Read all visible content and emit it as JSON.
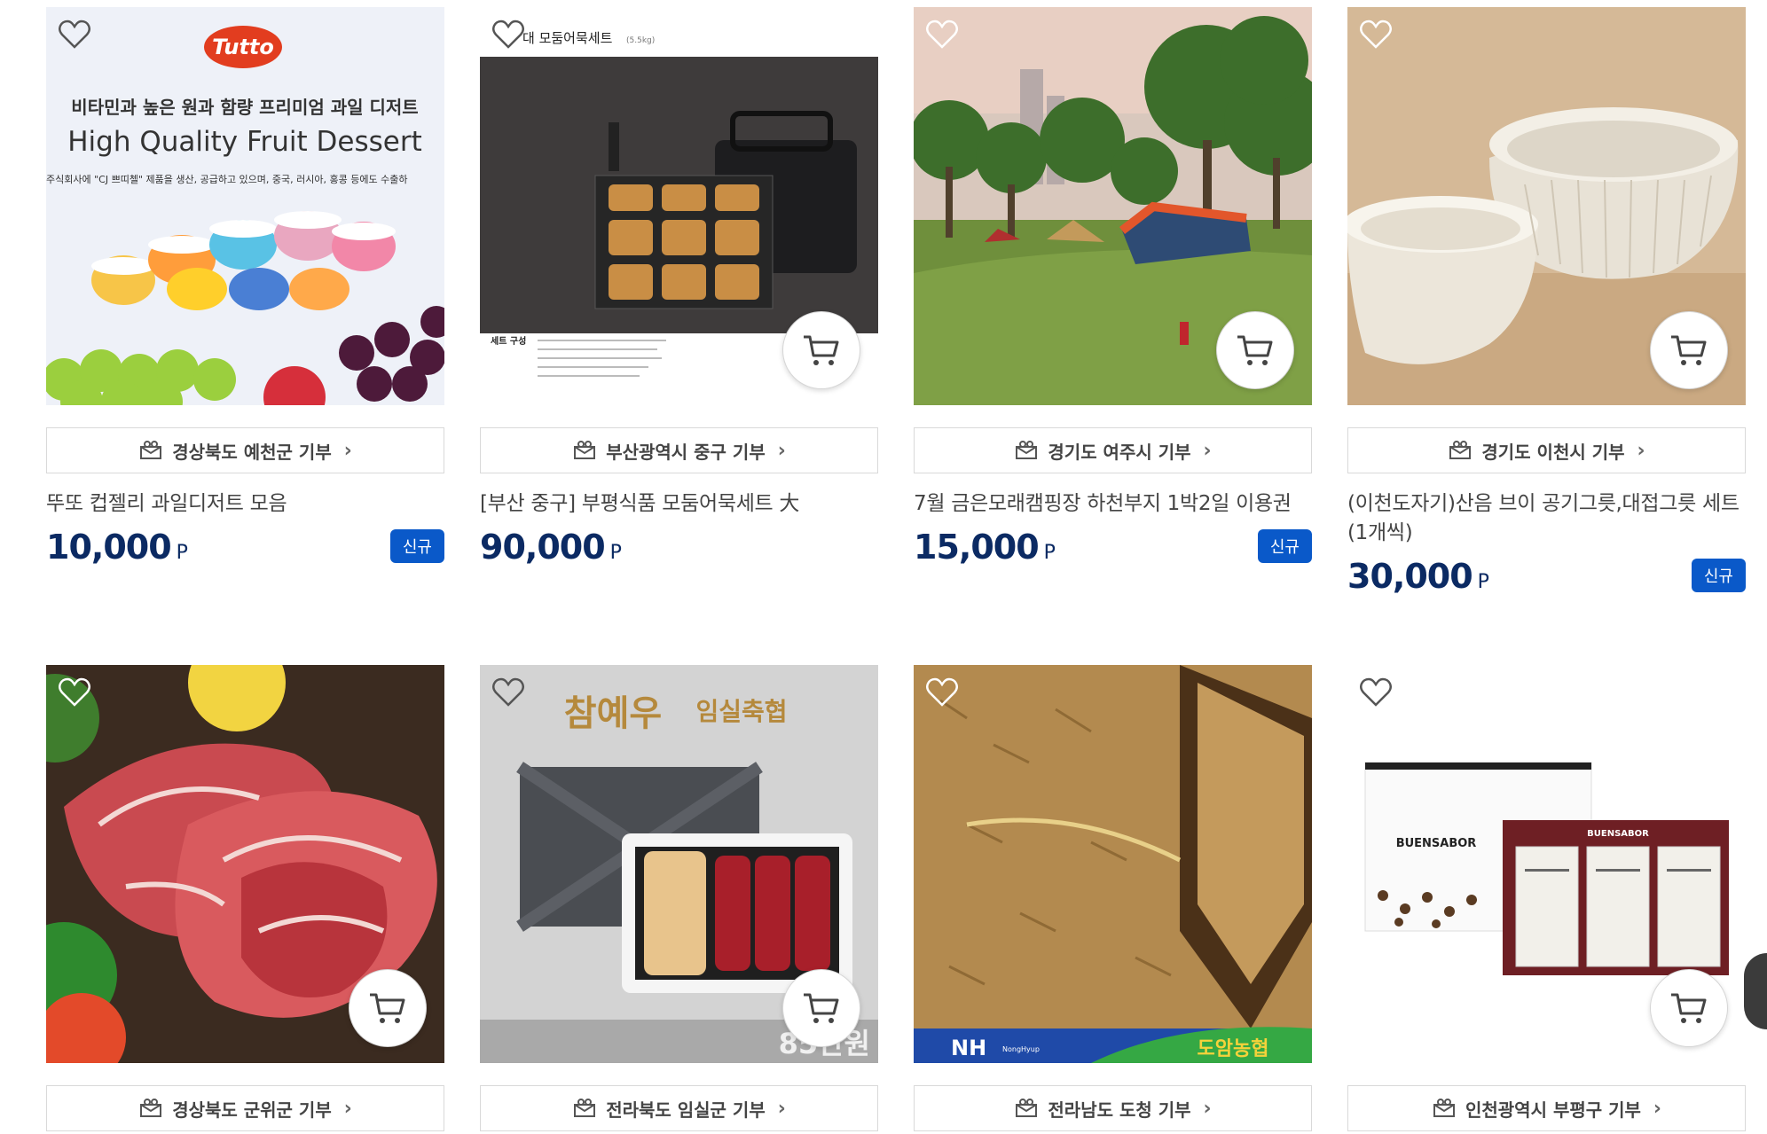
{
  "products": [
    {
      "image": "tutto-fruit-jelly",
      "region": "경상북도 예천군 기부",
      "name": "뚜또 컵젤리 과일디저트 모음",
      "price": "10,000",
      "unit": "P",
      "badge": "신규",
      "img_text": {
        "brand": "Tutto",
        "headline_ko": "비타민과 높은 원과 함량 프리미엄 과일 디저트",
        "headline_en": "High Quality Fruit Dessert",
        "caption": "주식회사에 \"CJ 쁘띠첼\" 제품을 생산, 공급하고 있으며, 중국, 러시아, 홍콩 등에도 수출하"
      }
    },
    {
      "image": "fishcake-set",
      "region": "부산광역시 중구 기부",
      "name": "[부산 중구] 부평식품 모둠어묵세트 大",
      "price": "90,000",
      "unit": "P",
      "badge": "",
      "img_text": {
        "title": "대 모둠어묵세트",
        "weight": "(5.5kg)",
        "set_label": "세트 구성"
      }
    },
    {
      "image": "camping-site",
      "region": "경기도 여주시 기부",
      "name": "7월 금은모래캠핑장 하천부지 1박2일 이용권",
      "price": "15,000",
      "unit": "P",
      "badge": "신규"
    },
    {
      "image": "ceramic-bowls",
      "region": "경기도 이천시 기부",
      "name": "(이천도자기)산음 브이 공기그릇,대접그릇 세트(1개씩)",
      "price": "30,000",
      "unit": "P",
      "badge": "신규"
    },
    {
      "image": "pork-neck",
      "region": "경상북도 군위군 기부"
    },
    {
      "image": "hanwoo-gift-set",
      "region": "전라북도 임실군 기부",
      "img_text": {
        "brand": "참예우",
        "coop": "임실축협",
        "price_tag": "85만원"
      }
    },
    {
      "image": "oats-grain",
      "region": "전라남도 도청 기부",
      "img_text": {
        "nh": "NH",
        "nh_sub": "NongHyup",
        "coop": "도암농협"
      }
    },
    {
      "image": "buensabor-coffee",
      "region": "인천광역시 부평구 기부",
      "img_text": {
        "brand": "BUENSABOR"
      }
    }
  ],
  "colors": {
    "price": "#0b2a63",
    "badge": "#0a59c9",
    "border": "#d9d9d9"
  },
  "icons": {
    "wishlist": "heart-outline-icon",
    "cart": "cart-icon",
    "donate": "gift-box-icon",
    "arrow": "chevron-right-icon"
  }
}
